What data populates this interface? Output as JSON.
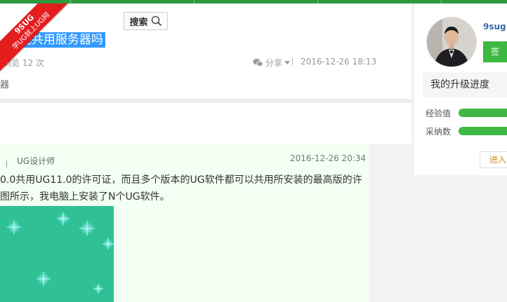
{
  "badge": {
    "line1": "9SUG",
    "line2": "学UG就上UG网"
  },
  "search": {
    "label": "搜索",
    "icon": "search-icon"
  },
  "question": {
    "title_visible": "0能共用服务器吗",
    "views": "浏览 12 次",
    "share_label": "分享",
    "date": "2016-12-26 18:13",
    "left_fragment": "器"
  },
  "answer": {
    "role": "UG设计师",
    "date": "2016-12-26 20:34",
    "line1": "0.0共用UG11.0的许可证，而且多个版本的UG软件都可以共用所安装的最高版的许",
    "line2": "图所示，我电脑上安装了N个UG软件。"
  },
  "sidebar": {
    "username": "9sug",
    "sign_button": "签",
    "progress_title": "我的升级进度",
    "exp_label": "经验值",
    "adopt_label": "采纳数",
    "enter_button": "进入",
    "exp_progress": 1.0,
    "adopt_progress": 1.0
  },
  "colors": {
    "brand_green": "#2d9b3c",
    "accent_green": "#3fb843",
    "selection_blue": "#3399ff",
    "ribbon_red": "#e41d1d",
    "answer_bg": "#f3fff3"
  }
}
